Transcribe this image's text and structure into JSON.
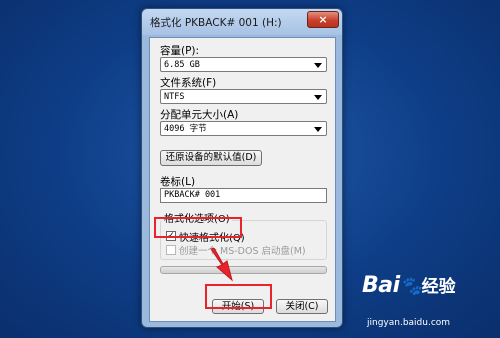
{
  "window": {
    "title": "格式化 PKBACK# 001 (H:)",
    "close_glyph": "×"
  },
  "capacity": {
    "label": "容量(P):",
    "value": "6.85 GB"
  },
  "filesystem": {
    "label": "文件系统(F)",
    "value": "NTFS"
  },
  "allocation": {
    "label": "分配单元大小(A)",
    "value": "4096 字节"
  },
  "restore_defaults_label": "还原设备的默认值(D)",
  "volume": {
    "label": "卷标(L)",
    "value": "PKBACK# 001"
  },
  "options": {
    "title": "格式化选项(O)",
    "quick_format": {
      "label": "快速格式化(Q)",
      "checked": true,
      "check_glyph": "✓"
    },
    "msdos": {
      "label": "创建一个 MS-DOS 启动盘(M)",
      "checked": false
    }
  },
  "progress": {
    "value": 0
  },
  "buttons": {
    "start": "开始(S)",
    "close": "关闭(C)"
  },
  "watermark": {
    "brand": "Bai",
    "paw": "🐾",
    "brand2": "经验",
    "url": "jingyan.baidu.com"
  },
  "colors": {
    "highlight": "#e8232c",
    "desktop": "#0e3d86"
  }
}
